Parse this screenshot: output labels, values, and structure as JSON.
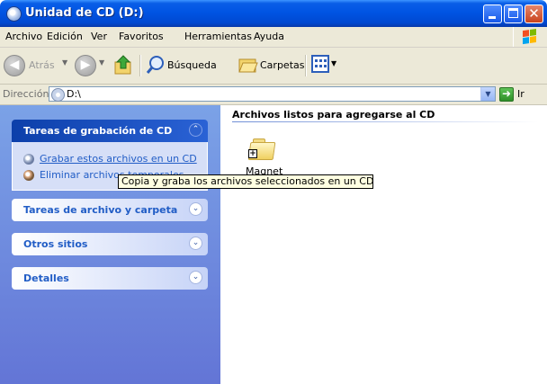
{
  "window": {
    "title": "Unidad de CD (D:)",
    "icon": "cd-drive-icon"
  },
  "menu": {
    "items": [
      "Archivo",
      "Edición",
      "Ver",
      "Favoritos",
      "Herramientas",
      "Ayuda"
    ]
  },
  "toolbar": {
    "back_label": "Atrás",
    "search_label": "Búsqueda",
    "folders_label": "Carpetas"
  },
  "address": {
    "label": "Dirección",
    "value": "D:\\",
    "go_label": "Ir"
  },
  "sidebar": {
    "cd_tasks": {
      "title": "Tareas de grabación de CD",
      "items": [
        "Grabar estos archivos en un CD",
        "Eliminar archivos temporales"
      ]
    },
    "file_tasks": {
      "title": "Tareas de archivo y carpeta"
    },
    "other_places": {
      "title": "Otros sitios"
    },
    "details": {
      "title": "Detalles"
    }
  },
  "content": {
    "group_title": "Archivos listos para agregarse al CD",
    "items": [
      {
        "name": "Magnet"
      }
    ]
  },
  "tooltip": {
    "text": "Copia y graba los archivos seleccionados en un CD grabable."
  },
  "colors": {
    "titlebar": "#0054e3",
    "sidebar": "#6f8ee0",
    "link": "#215dc6",
    "tooltip_bg": "#ffffe1"
  }
}
